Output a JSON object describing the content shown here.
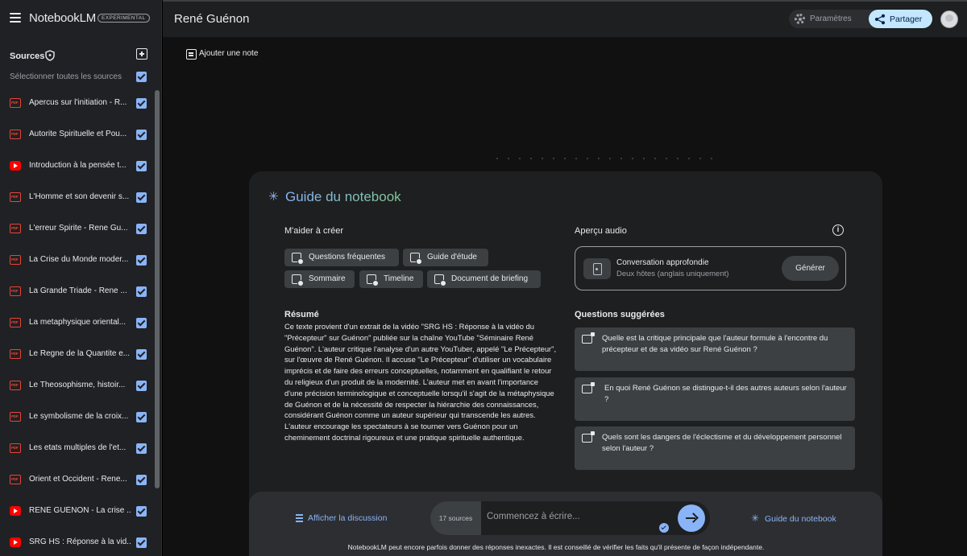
{
  "app": {
    "name": "NotebookLM",
    "badge": "EXPERIMENTAL"
  },
  "header": {
    "notebook_title": "René Guénon",
    "settings_label": "Paramètres",
    "share_label": "Partager"
  },
  "sidebar": {
    "sources_title": "Sources",
    "select_all_label": "Sélectionner toutes les sources",
    "items": [
      {
        "type": "pdf",
        "label": "Apercus sur l'initiation - R..."
      },
      {
        "type": "pdf",
        "label": "Autorite Spirituelle et Pou..."
      },
      {
        "type": "youtube",
        "label": "Introduction à la pensée t..."
      },
      {
        "type": "pdf",
        "label": "L'Homme et son devenir s..."
      },
      {
        "type": "pdf",
        "label": "L'erreur Spirite - Rene Gu..."
      },
      {
        "type": "pdf",
        "label": "La Crise du Monde moder..."
      },
      {
        "type": "pdf",
        "label": "La Grande Triade - Rene ..."
      },
      {
        "type": "pdf",
        "label": "La metaphysique oriental..."
      },
      {
        "type": "pdf",
        "label": "Le Regne de la Quantite e..."
      },
      {
        "type": "pdf",
        "label": "Le Theosophisme, histoir..."
      },
      {
        "type": "pdf",
        "label": "Le symbolisme de la croix..."
      },
      {
        "type": "pdf",
        "label": "Les etats multiples de l'et..."
      },
      {
        "type": "pdf",
        "label": "Orient et Occident - Rene..."
      },
      {
        "type": "youtube",
        "label": "RENÉ GUÉNON - La crise ..."
      },
      {
        "type": "youtube",
        "label": "SRG HS : Réponse à la vid..."
      }
    ]
  },
  "main": {
    "add_note_label": "Ajouter une note"
  },
  "guide": {
    "title": "Guide du notebook",
    "help_title": "M'aider à créer",
    "chips": [
      {
        "label": "Questions fréquentes"
      },
      {
        "label": "Guide d'étude"
      },
      {
        "label": "Sommaire"
      },
      {
        "label": "Timeline"
      },
      {
        "label": "Document de briefing"
      }
    ],
    "summary_title": "Résumé",
    "summary_text": "Ce texte provient d'un extrait de la vidéo \"SRG HS : Réponse à la vidéo du \"Précepteur\" sur Guénon\" publiée sur la chaîne YouTube \"Séminaire René Guénon\". L'auteur critique l'analyse d'un autre YouTuber, appelé \"Le Précepteur\", sur l'œuvre de René Guénon. Il accuse \"Le Précepteur\" d'utiliser un vocabulaire imprécis et de faire des erreurs conceptuelles, notamment en qualifiant le retour du religieux d'un produit de la modernité. L'auteur met en avant l'importance d'une précision terminologique et conceptuelle lorsqu'il s'agit de la métaphysique de Guénon et de la nécessité de respecter la hiérarchie des connaissances, considérant Guénon comme un auteur supérieur qui transcende les autres. L'auteur encourage les spectateurs à se tourner vers Guénon pour un cheminement doctrinal rigoureux et une pratique spirituelle authentique.",
    "audio_title": "Aperçu audio",
    "audio_name": "Conversation approfondie",
    "audio_sub": "Deux hôtes (anglais uniquement)",
    "generate_label": "Générer",
    "questions_title": "Questions suggérées",
    "questions": [
      {
        "text": "Quelle est la critique principale que l'auteur formule à l'encontre du précepteur et de sa vidéo sur René Guénon ?"
      },
      {
        "text": "En quoi René Guénon se distingue-t-il des autres auteurs selon l'auteur ?"
      },
      {
        "text": "Quels sont les dangers de l'éclectisme et du développement personnel selon l'auteur ?"
      }
    ]
  },
  "chatbar": {
    "show_discussion_label": "Afficher la discussion",
    "source_count": "17 sources",
    "input_placeholder": "Commencez à écrire...",
    "guide_link_label": "Guide du notebook"
  },
  "disclaimer": "NotebookLM peut encore parfois donner des réponses inexactes. Il est conseillé de vérifier les faits qu'il présente de façon indépendante."
}
